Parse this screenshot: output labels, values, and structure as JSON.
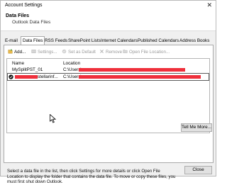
{
  "window": {
    "title": "Account Settings",
    "close_glyph": "✕"
  },
  "header": {
    "title": "Data Files",
    "subtitle": "Outlook Data Files"
  },
  "tabs": [
    {
      "label": "E-mail",
      "active": false
    },
    {
      "label": "Data Files",
      "active": true
    },
    {
      "label": "RSS Feeds",
      "active": false
    },
    {
      "label": "SharePoint Lists",
      "active": false
    },
    {
      "label": "Internet Calendars",
      "active": false
    },
    {
      "label": "Published Calendars",
      "active": false
    },
    {
      "label": "Address Books",
      "active": false
    }
  ],
  "toolbar": {
    "add": "Add...",
    "settings": "Settings...",
    "set_default": "Set as Default",
    "remove": "Remove",
    "open_location": "Open File Location..."
  },
  "list": {
    "columns": {
      "name": "Name",
      "location": "Location"
    },
    "rows": [
      {
        "name": "MySplitPST_01",
        "location": "C:\\Users\\",
        "selected": false,
        "default": false
      },
      {
        "name": "stellarinf...",
        "location": "C:\\Users\\",
        "selected": true,
        "default": true
      }
    ]
  },
  "description": "Select a data file in the list, then click Settings for more details or click Open File Location to display the folder that contains the data file. To move or copy these files, you must first shut down Outlook.",
  "buttons": {
    "tell_me_more": "Tell Me More...",
    "close": "Close"
  },
  "colors": {
    "redaction": "#ef2f3b",
    "panel_bg": "#ffffff",
    "dialog_bg": "#f0f0f0"
  }
}
